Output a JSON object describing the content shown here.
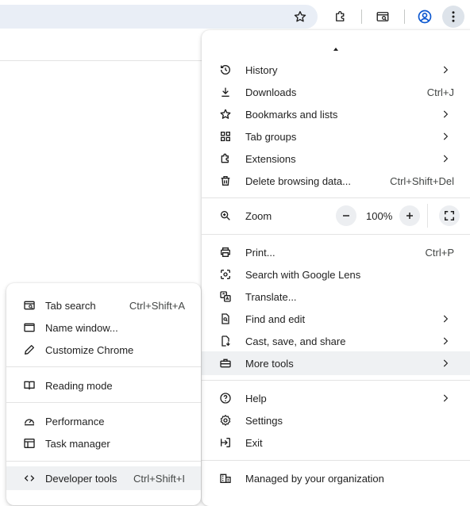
{
  "toolbar": {
    "icons": [
      "star-icon",
      "extensions-icon",
      "tab-search-icon",
      "profile-icon",
      "more-vert-icon"
    ]
  },
  "main_menu": {
    "items": [
      {
        "label": "History",
        "icon": "history-icon",
        "submenu": true
      },
      {
        "label": "Downloads",
        "icon": "download-icon",
        "shortcut": "Ctrl+J"
      },
      {
        "label": "Bookmarks and lists",
        "icon": "star-icon",
        "submenu": true
      },
      {
        "label": "Tab groups",
        "icon": "tab-groups-icon",
        "submenu": true
      },
      {
        "label": "Extensions",
        "icon": "extensions-icon",
        "submenu": true
      },
      {
        "label": "Delete browsing data...",
        "icon": "trash-icon",
        "shortcut": "Ctrl+Shift+Del"
      }
    ],
    "zoom": {
      "label": "Zoom",
      "value": "100%",
      "minus": "−",
      "plus": "+"
    },
    "items2": [
      {
        "label": "Print...",
        "icon": "print-icon",
        "shortcut": "Ctrl+P"
      },
      {
        "label": "Search with Google Lens",
        "icon": "lens-icon"
      },
      {
        "label": "Translate...",
        "icon": "translate-icon"
      },
      {
        "label": "Find and edit",
        "icon": "find-icon",
        "submenu": true
      },
      {
        "label": "Cast, save, and share",
        "icon": "cast-save-icon",
        "submenu": true
      },
      {
        "label": "More tools",
        "icon": "toolbox-icon",
        "submenu": true,
        "highlighted": true
      }
    ],
    "items3": [
      {
        "label": "Help",
        "icon": "help-icon",
        "submenu": true
      },
      {
        "label": "Settings",
        "icon": "settings-icon"
      },
      {
        "label": "Exit",
        "icon": "exit-icon"
      }
    ],
    "managed": {
      "label": "Managed by your organization",
      "icon": "building-icon"
    }
  },
  "sub_menu": {
    "items": [
      {
        "label": "Tab search",
        "icon": "tab-search-icon",
        "shortcut": "Ctrl+Shift+A"
      },
      {
        "label": "Name window...",
        "icon": "window-icon"
      },
      {
        "label": "Customize Chrome",
        "icon": "pencil-icon"
      },
      {
        "label": "Reading mode",
        "icon": "reading-mode-icon"
      },
      {
        "label": "Performance",
        "icon": "performance-icon"
      },
      {
        "label": "Task manager",
        "icon": "task-manager-icon"
      },
      {
        "label": "Developer tools",
        "icon": "code-icon",
        "shortcut": "Ctrl+Shift+I",
        "highlighted": true
      }
    ]
  },
  "colors": {
    "accent": "#0b57d0",
    "highlight": "#eff1f3",
    "omnibox": "#e9eef6"
  }
}
